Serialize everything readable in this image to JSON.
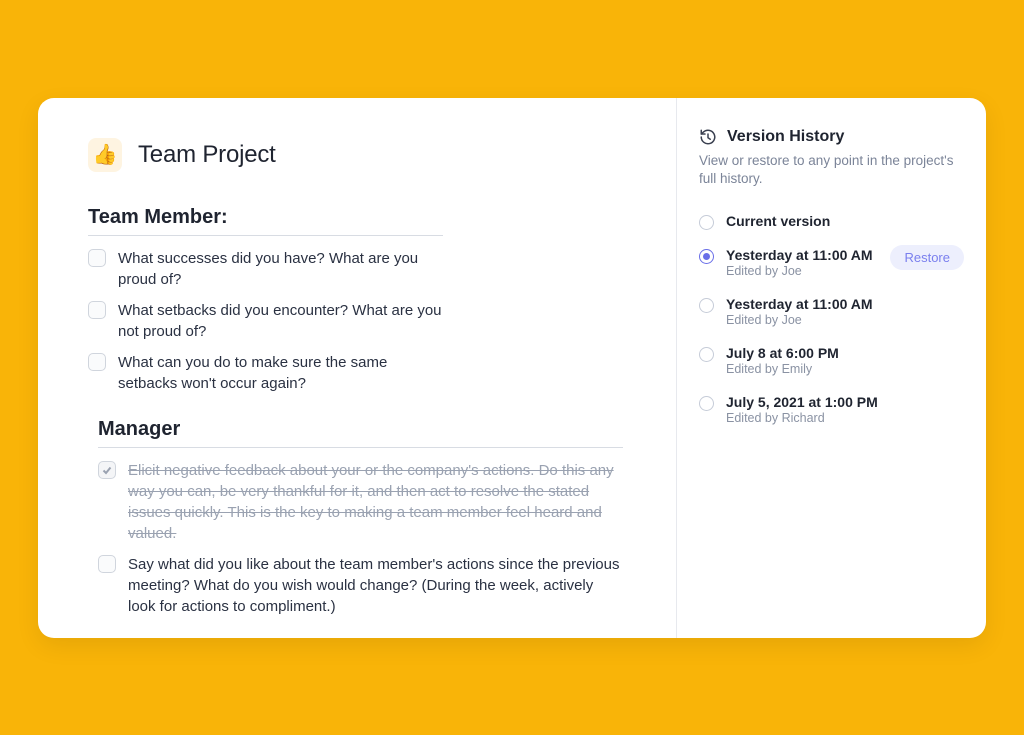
{
  "page": {
    "emoji": "👍",
    "title": "Team Project"
  },
  "sections": {
    "team": {
      "heading": "Team Member:",
      "items": [
        {
          "text": "What successes did you have? What are you proud of?",
          "checked": false
        },
        {
          "text": "What setbacks did you encounter? What are you not proud of?",
          "checked": false
        },
        {
          "text": "What can you do to make sure the same setbacks won't occur again?",
          "checked": false
        }
      ]
    },
    "manager": {
      "heading": "Manager",
      "items": [
        {
          "text": "Elicit negative feedback about your or the company's actions. Do this any way you can, be very thankful for it, and then act to resolve the stated issues quickly. This is the key to making a team member feel heard and valued.",
          "checked": true
        },
        {
          "text": "Say what did you like about the team member's actions since the previous meeting? What do you wish would change? (During the week, actively look for actions to compliment.)",
          "checked": false
        }
      ]
    }
  },
  "history": {
    "title": "Version History",
    "subtitle": "View or restore to any point in the project's full history.",
    "restore_label": "Restore",
    "versions": [
      {
        "label": "Current version",
        "sub": "",
        "selected": false,
        "restorable": false
      },
      {
        "label": "Yesterday at 11:00 AM",
        "sub": "Edited by Joe",
        "selected": true,
        "restorable": true
      },
      {
        "label": "Yesterday at 11:00 AM",
        "sub": "Edited by Joe",
        "selected": false,
        "restorable": false
      },
      {
        "label": "July 8 at 6:00 PM",
        "sub": "Edited by Emily",
        "selected": false,
        "restorable": false
      },
      {
        "label": "July 5, 2021 at 1:00 PM",
        "sub": "Edited by Richard",
        "selected": false,
        "restorable": false
      }
    ]
  }
}
